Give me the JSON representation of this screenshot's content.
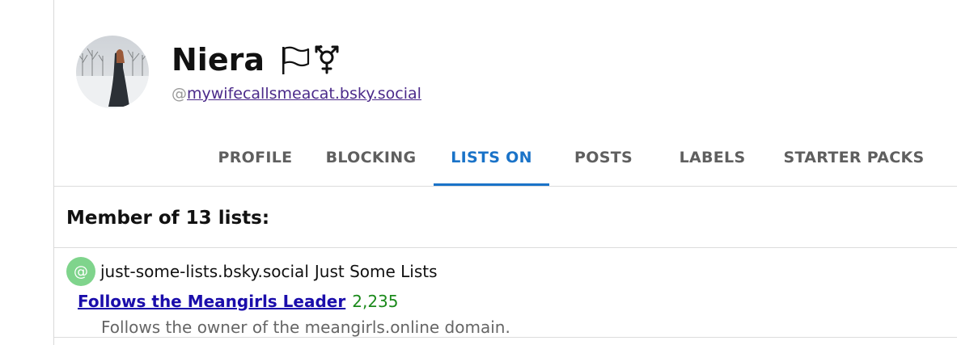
{
  "profile": {
    "display_name": "Niera",
    "handle_prefix": "@",
    "handle": "mywifecallsmeacat.bsky.social",
    "name_icons": [
      "white-flag-icon",
      "transgender-symbol-icon"
    ]
  },
  "tabs": [
    {
      "label": "PROFILE",
      "active": false
    },
    {
      "label": "BLOCKING",
      "active": false
    },
    {
      "label": "LISTS ON",
      "active": true
    },
    {
      "label": "POSTS",
      "active": false
    },
    {
      "label": "LABELS",
      "active": false
    },
    {
      "label": "STARTER PACKS",
      "active": false
    }
  ],
  "section": {
    "title": "Member of 13 lists:"
  },
  "lists": [
    {
      "owner_badge": "@",
      "owner_handle": "just-some-lists.bsky.social",
      "owner_name": "Just Some Lists",
      "title": "Follows the Meangirls Leader",
      "count": "2,235",
      "description": "Follows the owner of the meangirls.online domain."
    }
  ],
  "colors": {
    "accent": "#1a73c8",
    "link": "#1a0dab",
    "count": "#1b8a1b",
    "badge": "#7fd48c",
    "handle_link": "#4b2a8a"
  }
}
